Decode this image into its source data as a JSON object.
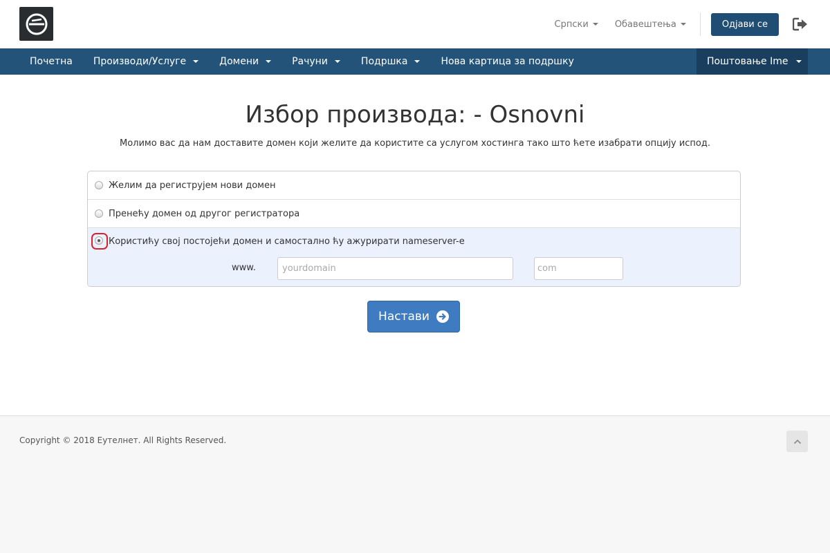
{
  "header": {
    "logo_icon": "eutelnet-logo-icon",
    "language": "Српски",
    "notifications": "Обавештења",
    "logout_label": "Одјави се",
    "exit_icon": "sign-out-icon"
  },
  "nav": {
    "items": [
      {
        "label": "Почетна"
      },
      {
        "label": "Производи/Услуге"
      },
      {
        "label": "Домени"
      },
      {
        "label": "Рачуни"
      },
      {
        "label": "Подршка"
      },
      {
        "label": "Нова картица за подршку"
      }
    ],
    "user": "Поштовање Ime"
  },
  "main": {
    "title": "Избор производа: - Osnovni",
    "intro": "Молимо вас да нам доставите домен који желите да користите са услугом хостинга тако што ћете изабрати опцију испод.",
    "options": [
      {
        "label": "Желим да региструјем нови домен",
        "checked": false
      },
      {
        "label": "Пренећу домен од другог регистратора",
        "checked": false
      },
      {
        "label": "Користићу свој постојећи домен и самостално ћу ажурирати nameserver-е",
        "checked": true
      }
    ],
    "www_label": "www.",
    "domain_placeholder": "yourdomain",
    "tld_placeholder": "com",
    "continue_label": "Настави"
  },
  "footer": {
    "copyright": "Copyright © 2018 Еутелнет. All Rights Reserved."
  },
  "colors": {
    "navbar": "#235378",
    "accent_button": "#3f7bc0",
    "selected_option_bg": "#ebf1fd",
    "highlight_ring": "#d9232c"
  }
}
